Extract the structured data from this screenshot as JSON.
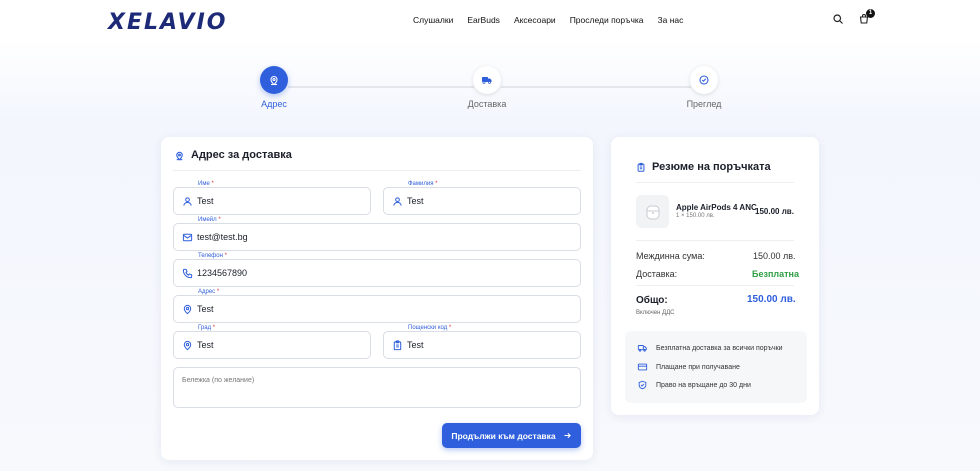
{
  "header": {
    "logo": "XELAVIO",
    "nav": [
      "Слушалки",
      "EarBuds",
      "Аксесоари",
      "Проследи поръчка",
      "За нас"
    ],
    "cart_count": "1",
    "icons": [
      "search-icon",
      "cart-icon"
    ]
  },
  "stepper": {
    "steps": [
      {
        "label": "Адрес",
        "active": true,
        "icon": "location-icon"
      },
      {
        "label": "Доставка",
        "active": false,
        "icon": "truck-icon"
      },
      {
        "label": "Преглед",
        "active": false,
        "icon": "check-badge-icon"
      }
    ]
  },
  "form": {
    "title": "Адрес за доставка",
    "fields": {
      "first_name": {
        "label": "Име",
        "value": "Test"
      },
      "last_name": {
        "label": "Фамилия",
        "value": "Test"
      },
      "email": {
        "label": "Имейл",
        "value": "test@test.bg"
      },
      "phone": {
        "label": "Телефон",
        "value": "1234567890"
      },
      "address": {
        "label": "Адрес",
        "value": "Test"
      },
      "city": {
        "label": "Град",
        "value": "Test"
      },
      "postal": {
        "label": "Пощенски код",
        "value": "Test"
      }
    },
    "note_placeholder": "Бележка (по желание)",
    "submit_label": "Продължи към доставка"
  },
  "summary": {
    "title": "Резюме на поръчката",
    "product": {
      "name": "Apple AirPods 4 ANC",
      "qty": "1 × 150.00 лв.",
      "price": "150.00 лв."
    },
    "subtotal_label": "Междинна сума:",
    "subtotal_value": "150.00 лв.",
    "shipping_label": "Доставка:",
    "shipping_value": "Безплатна",
    "total_label": "Общо:",
    "total_value": "150.00 лв.",
    "vat_note": "Включен ДДС",
    "perks": [
      "Безплатна доставка за всички поръчки",
      "Плащане при получаване",
      "Право на връщане до 30 дни"
    ]
  },
  "colors": {
    "accent": "#2f5fdc",
    "success": "#2f9e44",
    "required": "#e03131"
  }
}
